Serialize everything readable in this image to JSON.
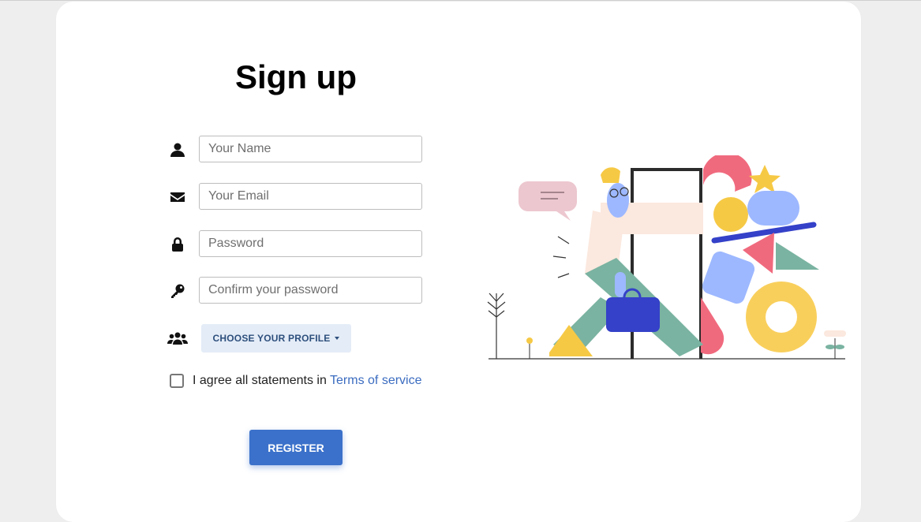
{
  "form": {
    "title": "Sign up",
    "fields": {
      "name": {
        "placeholder": "Your Name",
        "value": ""
      },
      "email": {
        "placeholder": "Your Email",
        "value": ""
      },
      "password": {
        "placeholder": "Password",
        "value": ""
      },
      "confirm": {
        "placeholder": "Confirm your password",
        "value": ""
      }
    },
    "profile_button_label": "CHOOSE YOUR PROFILE",
    "agree_text": "I agree all statements in ",
    "terms_link": "Terms of service",
    "register_label": "REGISTER",
    "agree_checked": false
  },
  "icons": {
    "name": "user-icon",
    "email": "envelope-icon",
    "password": "lock-icon",
    "confirm": "key-icon",
    "profile": "users-icon",
    "illustration": "signup-illustration"
  },
  "colors": {
    "primary": "#3b71ca",
    "link": "#3b6cc0",
    "profile_button_bg": "#e4ecf7",
    "profile_button_text": "#2d4f7c"
  }
}
